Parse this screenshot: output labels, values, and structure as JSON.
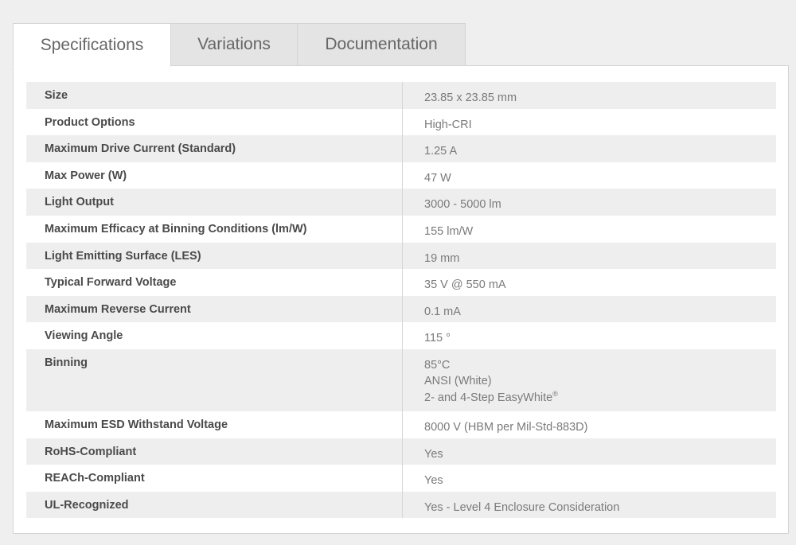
{
  "tabs": [
    {
      "label": "Specifications",
      "active": true
    },
    {
      "label": "Variations",
      "active": false
    },
    {
      "label": "Documentation",
      "active": false
    }
  ],
  "specs": [
    {
      "label": "Size",
      "values": [
        "23.85 x 23.85 mm"
      ]
    },
    {
      "label": "Product Options",
      "values": [
        "High-CRI"
      ]
    },
    {
      "label": "Maximum Drive Current (Standard)",
      "values": [
        "1.25 A"
      ]
    },
    {
      "label": "Max Power (W)",
      "values": [
        "47 W"
      ]
    },
    {
      "label": "Light Output",
      "values": [
        "3000 - 5000 lm"
      ]
    },
    {
      "label": "Maximum Efficacy at Binning Conditions (lm/W)",
      "values": [
        "155 lm/W"
      ]
    },
    {
      "label": "Light Emitting Surface (LES)",
      "values": [
        "19 mm"
      ]
    },
    {
      "label": "Typical Forward Voltage",
      "values": [
        "35 V @ 550 mA"
      ]
    },
    {
      "label": "Maximum Reverse Current",
      "values": [
        "0.1 mA"
      ]
    },
    {
      "label": "Viewing Angle",
      "values": [
        "115 °"
      ]
    },
    {
      "label": "Binning",
      "values": [
        "85°C",
        "ANSI (White)",
        "2- and 4-Step EasyWhite"
      ]
    },
    {
      "label": "Maximum ESD Withstand Voltage",
      "values": [
        "8000 V (HBM per Mil-Std-883D)"
      ]
    },
    {
      "label": "RoHS-Compliant",
      "values": [
        "Yes"
      ]
    },
    {
      "label": "REACh-Compliant",
      "values": [
        "Yes"
      ]
    },
    {
      "label": "UL-Recognized",
      "values": [
        "Yes - Level 4 Enclosure Consideration"
      ]
    }
  ],
  "trademark_symbol": "®"
}
